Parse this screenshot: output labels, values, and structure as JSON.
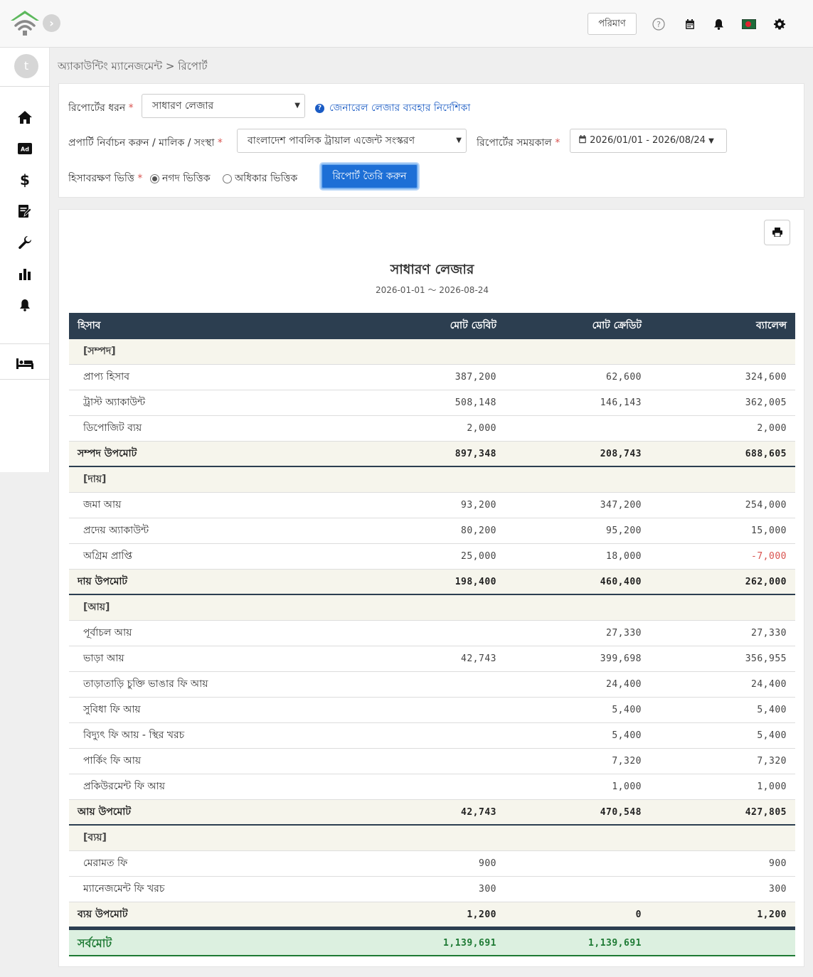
{
  "topbar": {
    "unit_label": "পরিমাণ"
  },
  "sidebar": {
    "avatar_letter": "t"
  },
  "breadcrumb": "অ্যাকাউন্টিং ম্যানেজমেন্ট > রিপোর্ট",
  "filters": {
    "report_type_label": "রিপোর্টের ধরন",
    "report_type_value": "সাধারণ লেজার",
    "guide_link": "জেনারেল লেজার ব্যবহার নির্দেশিকা",
    "property_label": "প্রপার্টি নির্বাচন করুন / মালিক / সংস্থা",
    "property_value": "বাংলাদেশ পাবলিক ট্রায়াল এজেন্ট সংস্করণ",
    "period_label": "রিপোর্টের সময়কাল",
    "period_value": "2026/01/01 - 2026/08/24",
    "basis_label": "হিসাবরক্ষণ ভিত্তি",
    "basis_cash": "নগদ ভিত্তিক",
    "basis_accrual": "অধিকার ভিত্তিক",
    "generate_label": "রিপোর্ট তৈরি করুন",
    "required_mark": "*"
  },
  "report": {
    "title": "সাধারণ লেজার",
    "range": "2026-01-01 〜 2026-08-24",
    "columns": {
      "account": "হিসাব",
      "debit": "মোট ডেবিট",
      "credit": "মোট ক্রেডিট",
      "balance": "ব্যালেন্স"
    },
    "rows": [
      {
        "type": "cat",
        "account": "[সম্পদ]",
        "debit": "",
        "credit": "",
        "balance": ""
      },
      {
        "type": "item",
        "account": "প্রাপ্য হিসাব",
        "debit": "387,200",
        "credit": "62,600",
        "balance": "324,600"
      },
      {
        "type": "item",
        "account": "ট্রাস্ট অ্যাকাউন্ট",
        "debit": "508,148",
        "credit": "146,143",
        "balance": "362,005"
      },
      {
        "type": "item",
        "account": "ডিপোজিট ব্যয়",
        "debit": "2,000",
        "credit": "",
        "balance": "2,000"
      },
      {
        "type": "sub",
        "account": "সম্পদ উপমোট",
        "debit": "897,348",
        "credit": "208,743",
        "balance": "688,605"
      },
      {
        "type": "cat",
        "account": "[দায়]",
        "debit": "",
        "credit": "",
        "balance": ""
      },
      {
        "type": "item",
        "account": "জমা আয়",
        "debit": "93,200",
        "credit": "347,200",
        "balance": "254,000"
      },
      {
        "type": "item",
        "account": "প্রদেয় অ্যাকাউন্ট",
        "debit": "80,200",
        "credit": "95,200",
        "balance": "15,000"
      },
      {
        "type": "item",
        "account": "অগ্রিম প্রাপ্তি",
        "debit": "25,000",
        "credit": "18,000",
        "balance": "-7,000",
        "negative": true
      },
      {
        "type": "sub",
        "account": "দায় উপমোট",
        "debit": "198,400",
        "credit": "460,400",
        "balance": "262,000"
      },
      {
        "type": "cat",
        "account": "[আয়]",
        "debit": "",
        "credit": "",
        "balance": ""
      },
      {
        "type": "item",
        "account": "পূর্বাচল আয়",
        "debit": "",
        "credit": "27,330",
        "balance": "27,330"
      },
      {
        "type": "item",
        "account": "ভাড়া আয়",
        "debit": "42,743",
        "credit": "399,698",
        "balance": "356,955"
      },
      {
        "type": "item",
        "account": "তাড়াতাড়ি চুক্তি ভাঙার ফি আয়",
        "debit": "",
        "credit": "24,400",
        "balance": "24,400"
      },
      {
        "type": "item",
        "account": "সুবিধা ফি আয়",
        "debit": "",
        "credit": "5,400",
        "balance": "5,400"
      },
      {
        "type": "item",
        "account": "বিদ্যুৎ ফি আয় - স্থির খরচ",
        "debit": "",
        "credit": "5,400",
        "balance": "5,400"
      },
      {
        "type": "item",
        "account": "পার্কিং ফি আয়",
        "debit": "",
        "credit": "7,320",
        "balance": "7,320"
      },
      {
        "type": "item",
        "account": "প্রকিউরমেন্ট ফি আয়",
        "debit": "",
        "credit": "1,000",
        "balance": "1,000"
      },
      {
        "type": "sub",
        "account": "আয় উপমোট",
        "debit": "42,743",
        "credit": "470,548",
        "balance": "427,805"
      },
      {
        "type": "cat",
        "account": "[ব্যয়]",
        "debit": "",
        "credit": "",
        "balance": ""
      },
      {
        "type": "item",
        "account": "মেরামত ফি",
        "debit": "900",
        "credit": "",
        "balance": "900"
      },
      {
        "type": "item",
        "account": "ম্যানেজমেন্ট ফি খরচ",
        "debit": "300",
        "credit": "",
        "balance": "300"
      },
      {
        "type": "sub",
        "account": "ব্যয় উপমোট",
        "debit": "1,200",
        "credit": "0",
        "balance": "1,200"
      }
    ],
    "total": {
      "account": "সর্বমোট",
      "debit": "1,139,691",
      "credit": "1,139,691",
      "balance": ""
    }
  }
}
